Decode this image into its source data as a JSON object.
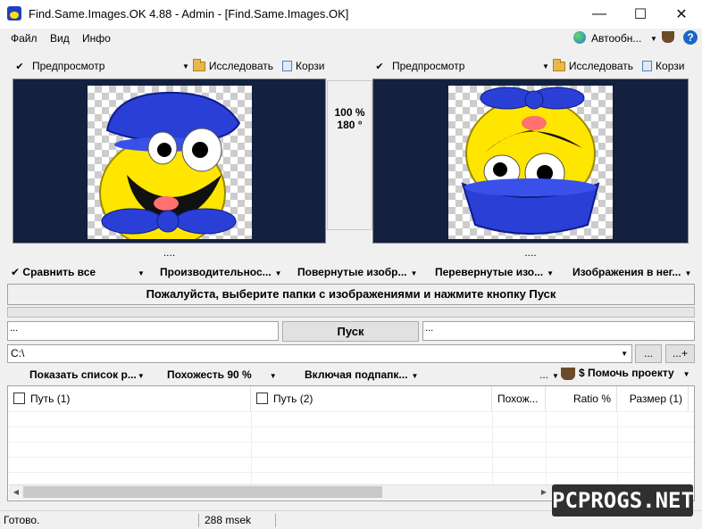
{
  "window": {
    "title": "Find.Same.Images.OK 4.88 - Admin - [Find.Same.Images.OK]",
    "minimize_glyph": "—",
    "maximize_glyph": "☐",
    "close_glyph": "✕"
  },
  "menu": {
    "items": [
      "Файл",
      "Вид",
      "Инфо"
    ],
    "auto_update": "Автообн...",
    "auto_update_arrow": "▼",
    "help": "?"
  },
  "left_pane": {
    "checkmark": "✔",
    "preview_label": "Предпросмотр",
    "explore_label": "Исследовать",
    "bin_label": "Корзи",
    "dots": "....",
    "arrow": "▼"
  },
  "right_pane": {
    "checkmark": "✔",
    "preview_label": "Предпросмотр",
    "explore_label": "Исследовать",
    "bin_label": "Корзи",
    "dots": "....",
    "arrow": "▼"
  },
  "middle_info": {
    "zoom": "100 %",
    "angle": "180 °"
  },
  "filters": {
    "checkmark": "✔",
    "compare_all": "Сравнить все",
    "performance": "Производительнос...",
    "rotated": "Повернутые изобр...",
    "flipped": "Перевернутые изо...",
    "negative": "Изображения в нег...",
    "arrow": "▼"
  },
  "message": "Пожалуйста, выберите папки с изображениями и нажмите кнопку Пуск",
  "side_left": "...",
  "side_right": "...",
  "start_button": "Пуск",
  "path": {
    "value": "C:\\",
    "arrow": "▼",
    "browse_btn": "...",
    "add_btn": "...+"
  },
  "options": {
    "show_list": "Показать список р...",
    "similarity": "Похожесть 90 %",
    "include_subfolders": "Включая подпапк...",
    "ellipsis": "...",
    "donate": "$ Помочь проекту",
    "arrow": "▼"
  },
  "table": {
    "columns": [
      "Путь (1)",
      "Путь (2)",
      "Похож...",
      "Ratio %",
      "Размер (1)"
    ]
  },
  "scrollbar": {
    "left_arrow": "◀",
    "right_arrow": "▶"
  },
  "status": {
    "text": "Готово.",
    "time": "288 msek"
  },
  "watermark": "PCPROGS.NET",
  "colors": {
    "preview_bg": "#13213f",
    "smiley_yellow": "#ffe600",
    "hat_blue": "#2a3fd6"
  }
}
